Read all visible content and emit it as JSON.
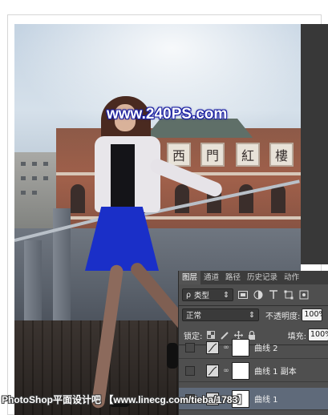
{
  "watermarks": {
    "top": "www.240PS.com",
    "bottom": "PhotoShop平面设计吧 【www.linecg.com/tieba/1783】"
  },
  "building_signs": [
    "西",
    "門",
    "紅",
    "樓"
  ],
  "layers_panel": {
    "tabs": [
      {
        "label": "图层",
        "active": true
      },
      {
        "label": "通道",
        "active": false
      },
      {
        "label": "路径",
        "active": false
      },
      {
        "label": "历史记录",
        "active": false
      },
      {
        "label": "动作",
        "active": false
      }
    ],
    "filter": {
      "search_glyph": "ρ",
      "kind_label": "类型",
      "arrows": "⇕",
      "icons": [
        "image-filter-icon",
        "adjustment-filter-icon",
        "type-filter-icon",
        "shape-filter-icon",
        "smart-object-filter-icon"
      ]
    },
    "blend_mode": {
      "value": "正常",
      "arrows": "⇕"
    },
    "opacity": {
      "label": "不透明度:",
      "value": "100%"
    },
    "lock": {
      "label": "锁定:"
    },
    "fill": {
      "label": "填充:",
      "value": "100%"
    },
    "layers": [
      {
        "name": "曲线 2",
        "visible_name": "曲线 2",
        "selected": false
      },
      {
        "name": "曲线 1 副本",
        "visible_name": "曲线 1 副本",
        "selected": false
      },
      {
        "name": "曲线 1",
        "visible_name": "曲线 1",
        "selected": true
      }
    ]
  },
  "colors": {
    "panel_bg": "#4f4f4f",
    "panel_tab_bar": "#3c3c3c",
    "selected_layer": "#5f6a7a",
    "watermark_outline": "#1a1fa0",
    "skirt_blue": "#1a2fc8"
  }
}
